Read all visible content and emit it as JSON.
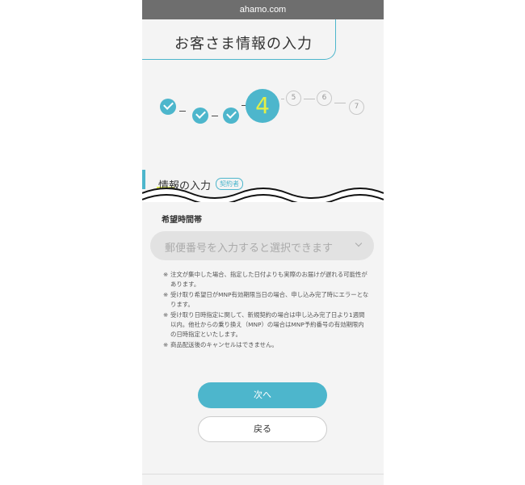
{
  "browser": {
    "url": "ahamo.com"
  },
  "page": {
    "title": "お客さま情報の入力"
  },
  "stepper": {
    "current": "4",
    "todo": [
      "5",
      "6",
      "7"
    ],
    "completed_count": 3
  },
  "section": {
    "title": "情報の入力",
    "badge": "契約者"
  },
  "field": {
    "label": "希望時間帯",
    "placeholder": "郵便番号を入力すると選択できます"
  },
  "notes": [
    {
      "mark": "※",
      "text": "注文が集中した場合、指定した日付よりも実際のお届けが遅れる可能性があります。"
    },
    {
      "mark": "※",
      "text": "受け取り希望日がMNP有効期限当日の場合、申し込み完了時にエラーとなります。"
    },
    {
      "mark": "※",
      "text": "受け取り日時指定に関して、新規契約の場合は申し込み完了日より1週間以内。他社からの乗り換え（MNP）の場合はMNP予約番号の有効期限内の日時指定といたします。"
    },
    {
      "mark": "※",
      "text": "商品配送後のキャンセルはできません。"
    }
  ],
  "buttons": {
    "next": "次へ",
    "back": "戻る"
  },
  "colors": {
    "accent": "#4db6cc",
    "highlight": "#e4ef45"
  }
}
